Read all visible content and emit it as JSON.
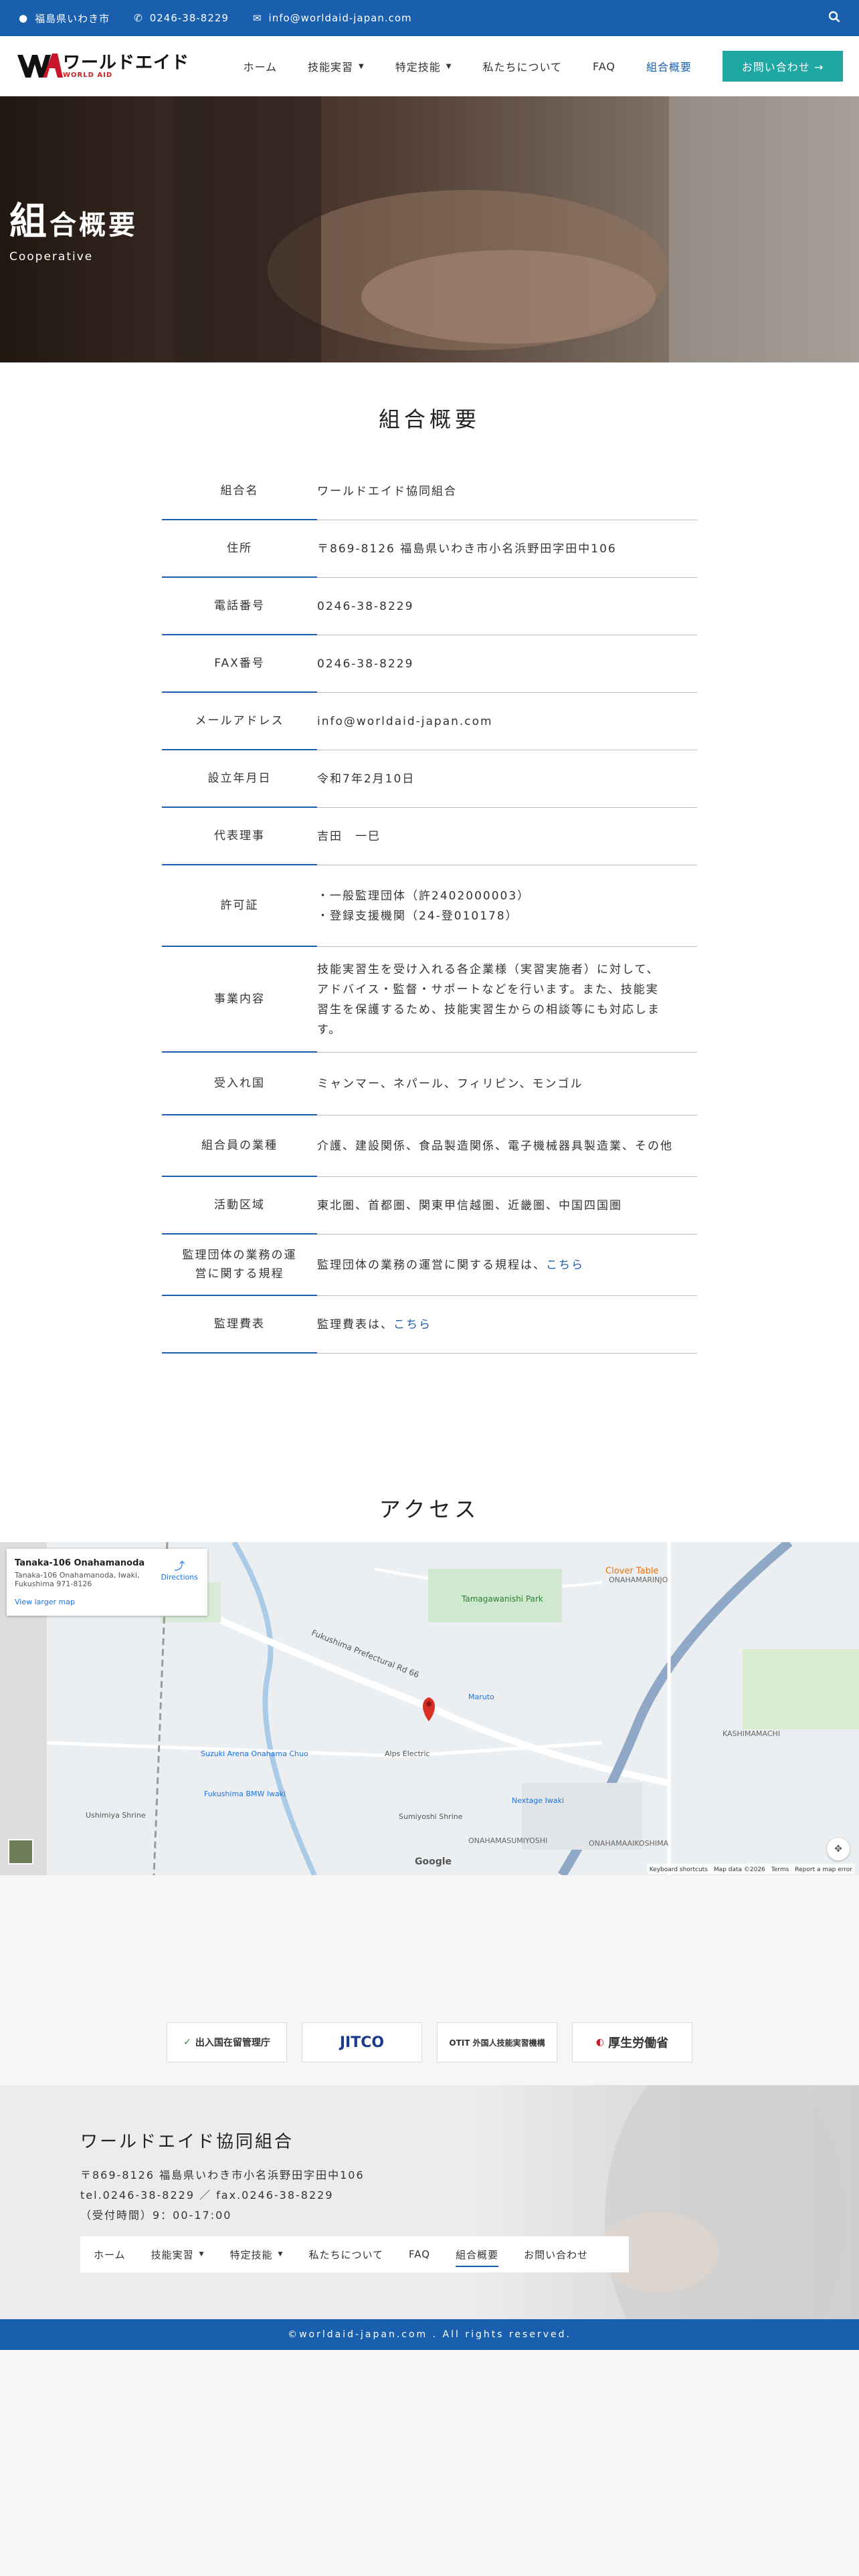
{
  "topbar": {
    "location": "福島県いわき市",
    "phone": "0246-38-8229",
    "email": "info@worldaid-japan.com"
  },
  "nav": {
    "logo_main": "ワールドエイド",
    "logo_sub": "WORLD AID",
    "items": [
      {
        "label": "ホーム"
      },
      {
        "label": "技能実習"
      },
      {
        "label": "特定技能"
      },
      {
        "label": "私たちについて"
      },
      {
        "label": "FAQ"
      },
      {
        "label": "組合概要"
      }
    ],
    "cta": "お問い合わせ →"
  },
  "hero": {
    "title_big": "組",
    "title_rest": "合概要",
    "subtitle": "Cooperative"
  },
  "overview": {
    "title": "組合概要",
    "rows": [
      {
        "key": "組合名",
        "value": "ワールドエイド協同組合"
      },
      {
        "key": "住所",
        "value": "〒869-8126 福島県いわき市小名浜野田字田中106"
      },
      {
        "key": "電話番号",
        "value": "0246-38-8229"
      },
      {
        "key": "FAX番号",
        "value": "0246-38-8229"
      },
      {
        "key": "メールアドレス",
        "value": "info@worldaid-japan.com"
      },
      {
        "key": "設立年月日",
        "value": "令和7年2月10日"
      },
      {
        "key": "代表理事",
        "value": "吉田　一巳"
      },
      {
        "key": "許可証",
        "line1": "・一般監理団体（許2402000003）",
        "line2": "・登録支援機関（24-登010178）"
      },
      {
        "key": "事業内容",
        "value": "技能実習生を受け入れる各企業様（実習実施者）に対して、アドバイス・監督・サポートなどを行います。また、技能実習生を保護するため、技能実習生からの相談等にも対応します。"
      },
      {
        "key": "受入れ国",
        "value": "ミャンマー、ネパール、フィリピン、モンゴル"
      },
      {
        "key": "組合員の業種",
        "value": "介護、建設関係、食品製造関係、電子機械器具製造業、その他"
      },
      {
        "key": "活動区域",
        "value": "東北圏、首都圏、関東甲信越圏、近畿圏、中国四国圏"
      },
      {
        "key": "監理団体の業務の運営に関する規程",
        "value": "監理団体の業務の運営に関する規程は、",
        "link": "こちら"
      },
      {
        "key": "監理費表",
        "value": "監理費表は、",
        "link": "こちら"
      }
    ]
  },
  "access": {
    "title": "アクセス",
    "map_place": "Tanaka-106 Onahamanoda",
    "map_addr1": "Tanaka-106 Onahamanoda, Iwaki,",
    "map_addr2": "Fukushima 971-8126",
    "map_directions": "Directions",
    "map_larger": "View larger map",
    "labels": {
      "park": "Tamagawanishi Park",
      "road": "Fukushima Prefectural Rd 66",
      "area1": "ONAHAMARINJO",
      "area2": "KASHIMAMACHI",
      "area3": "ONAHAMASUMIYOSHI",
      "area4": "ONAHAMAAIKOSHIMA",
      "store1": "Clover Table",
      "store2": "Suzuki Arena Onahama Chuo",
      "store3": "Fukushima BMW Iwaki",
      "store4": "Nextage Iwaki",
      "store5": "Maruto",
      "store6": "Alps Electric",
      "store7": "Ushimiya Shrine",
      "store8": "Sumiyoshi Shrine",
      "google": "Google",
      "footer_map": "Keyboard shortcuts　Map data ©2026　Terms　Report a map error"
    }
  },
  "partners": [
    {
      "label": "出入国在留管理庁"
    },
    {
      "label": "JITCO"
    },
    {
      "label": "OTIT 外国人技能実習機構"
    },
    {
      "label": "厚生労働省"
    }
  ],
  "footer": {
    "name": "ワールドエイド協同組合",
    "addr": "〒869-8126 福島県いわき市小名浜野田字田中106",
    "tel": "tel.0246-38-8229 ／ fax.0246-38-8229",
    "hours": "（受付時間）9：00-17:00",
    "nav": [
      {
        "label": "ホーム"
      },
      {
        "label": "技能実習"
      },
      {
        "label": "特定技能"
      },
      {
        "label": "私たちについて"
      },
      {
        "label": "FAQ"
      },
      {
        "label": "組合概要"
      },
      {
        "label": "お問い合わせ"
      }
    ],
    "copyright": "©worldaid-japan.com . All rights reserved."
  },
  "colors": {
    "brand": "#1a5fae",
    "cta": "#1fa7a4"
  }
}
